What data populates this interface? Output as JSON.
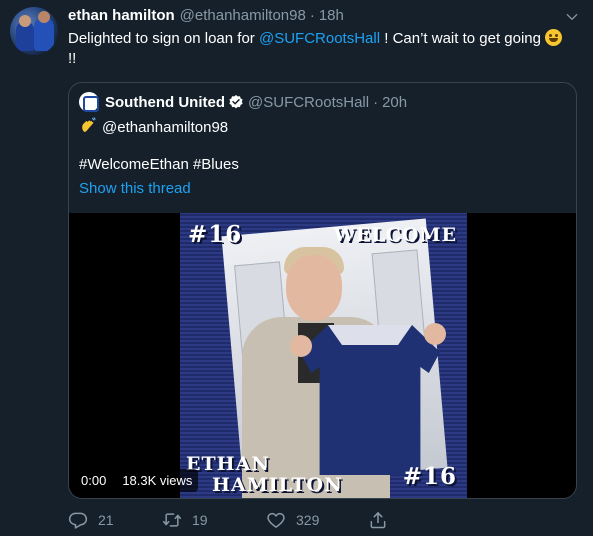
{
  "tweet": {
    "display_name": "ethan hamilton",
    "handle": "@ethanhamilton98",
    "separator": "·",
    "time": "18h",
    "text_before": "Delighted to sign on loan for ",
    "text_mention": "@SUFCRootsHall",
    "text_after": " ! Can’t wait to get going ",
    "text_line2": "!!",
    "emoji": "grinning-face"
  },
  "quote": {
    "display_name": "Southend United",
    "handle": "@SUFCRootsHall",
    "separator": "·",
    "time": "20h",
    "mention": "@ethanhamilton98",
    "hashtags": "#WelcomeEthan #Blues",
    "show_thread": "Show this thread",
    "media": {
      "poster_number_top": "#16",
      "poster_welcome": "WELCOME",
      "poster_first_name": "ETHAN",
      "poster_last_name": "HAMILTON",
      "poster_number_bottom": "#16",
      "duration": "0:00",
      "views": "18.3K views"
    }
  },
  "actions": {
    "replies": "21",
    "retweets": "19",
    "likes": "329"
  },
  "colors": {
    "background": "#15202b",
    "accent": "#1da1f2",
    "secondary_text": "#8899a6",
    "border": "#38444d"
  }
}
